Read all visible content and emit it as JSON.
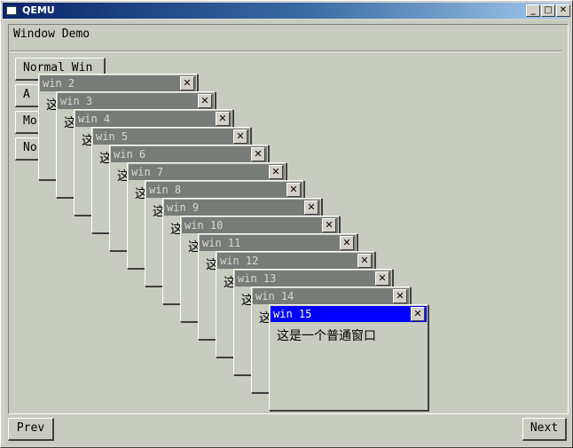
{
  "host_window": {
    "title": "QEMU",
    "minimize_label": "_",
    "maximize_label": "□",
    "close_label": "✕"
  },
  "demo": {
    "title": "Window Demo",
    "buttons": [
      {
        "label": "Normal Win"
      },
      {
        "label": "A"
      },
      {
        "label": "Mo"
      },
      {
        "label": "No"
      }
    ],
    "prev_label": "Prev",
    "next_label": "Next"
  },
  "windows": [
    {
      "title": "win 2",
      "body": "这"
    },
    {
      "title": "win 3",
      "body": "这"
    },
    {
      "title": "win 4",
      "body": "这"
    },
    {
      "title": "win 5",
      "body": "这"
    },
    {
      "title": "win 6",
      "body": "这"
    },
    {
      "title": "win 7",
      "body": "这"
    },
    {
      "title": "win 8",
      "body": "这"
    },
    {
      "title": "win 9",
      "body": "这"
    },
    {
      "title": "win 10",
      "body": "这"
    },
    {
      "title": "win 11",
      "body": "这"
    },
    {
      "title": "win 12",
      "body": "这"
    },
    {
      "title": "win 13",
      "body": "这"
    },
    {
      "title": "win 14",
      "body": "这"
    },
    {
      "title": "win 15",
      "body": "这是一个普通窗口",
      "active": true
    }
  ],
  "close_glyph": "✕",
  "colors": {
    "active_titlebar": "#0000ff",
    "inactive_titlebar": "#787c78",
    "desktop": "#c8ccc0"
  }
}
